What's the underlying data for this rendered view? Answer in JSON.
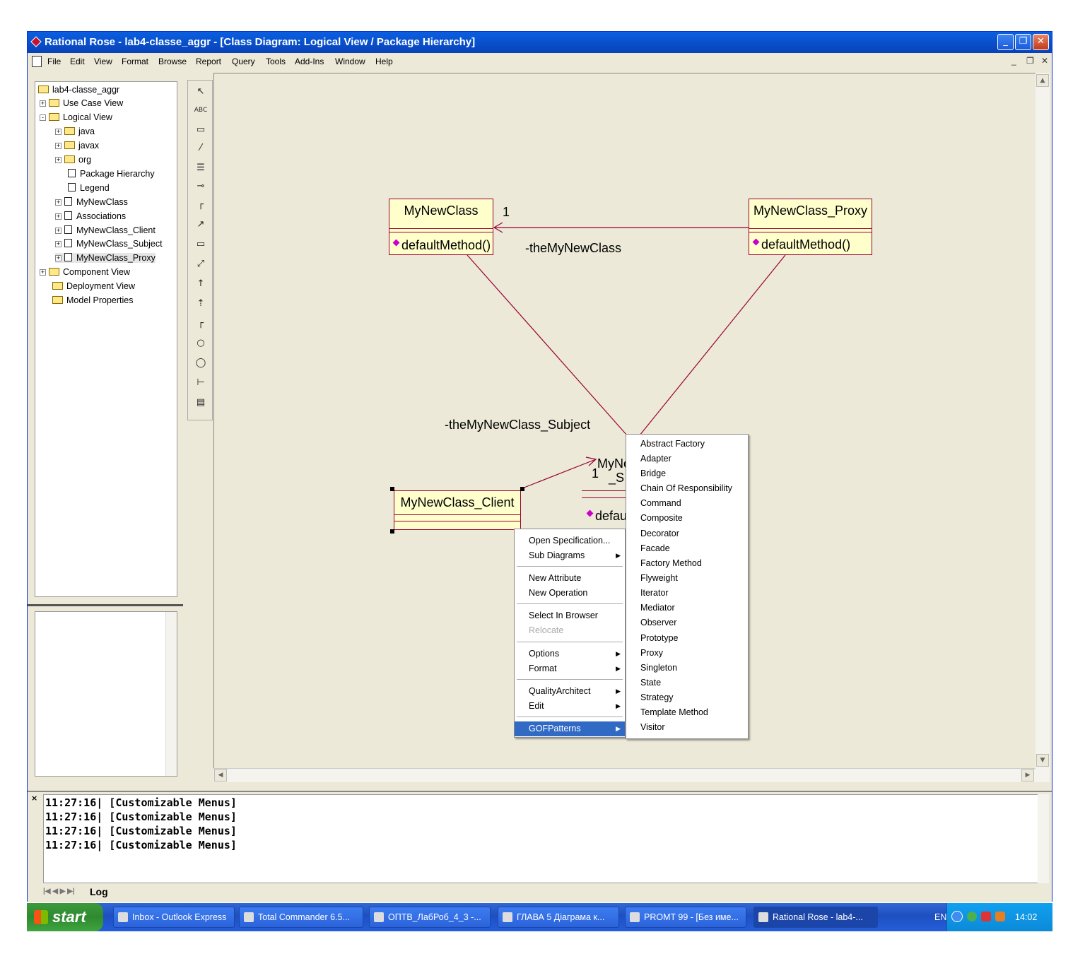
{
  "window": {
    "title": "Rational Rose - lab4-classe_aggr - [Class Diagram: Logical View / Package Hierarchy]",
    "minimize_glyph": "_",
    "restore_glyph": "❐",
    "close_glyph": "✕"
  },
  "menubar": {
    "items": [
      "File",
      "Edit",
      "View",
      "Format",
      "Browse",
      "Report",
      "Query",
      "Tools",
      "Add-Ins",
      "Window",
      "Help"
    ],
    "mdi_controls": [
      "_",
      "❐",
      "✕"
    ]
  },
  "browser": {
    "root": "lab4-classe_aggr",
    "nodes": [
      {
        "label": "Use Case View",
        "expander": "+"
      },
      {
        "label": "Logical View",
        "expander": "-"
      },
      {
        "label": "java",
        "expander": "+"
      },
      {
        "label": "javax",
        "expander": "+"
      },
      {
        "label": "org",
        "expander": "+"
      },
      {
        "label": "Package Hierarchy",
        "expander": ""
      },
      {
        "label": "Legend",
        "expander": ""
      },
      {
        "label": "MyNewClass",
        "expander": "+"
      },
      {
        "label": "Associations",
        "expander": "+"
      },
      {
        "label": "MyNewClass_Client",
        "expander": "+"
      },
      {
        "label": "MyNewClass_Subject",
        "expander": "+"
      },
      {
        "label": "MyNewClass_Proxy",
        "expander": "+"
      },
      {
        "label": "Component View",
        "expander": "+"
      },
      {
        "label": "Deployment View",
        "expander": ""
      },
      {
        "label": "Model Properties",
        "expander": ""
      }
    ]
  },
  "toolbox": {
    "tools": [
      "pointer-icon",
      "text-icon",
      "note-icon",
      "anchor-note-icon",
      "class-icon",
      "interface-icon",
      "association-icon",
      "unidirectional-association-icon",
      "package-icon",
      "dependency-icon",
      "generalization-icon",
      "realize-icon",
      "aggregation-icon",
      "boundary-icon",
      "entity-icon",
      "control-icon",
      "component-icon"
    ],
    "text_tool_label": "ABC"
  },
  "diagram": {
    "classes": {
      "mynewclass": {
        "name": "MyNewClass",
        "operation": "defaultMethod()"
      },
      "proxy": {
        "name": "MyNewClass_Proxy",
        "operation": "defaultMethod()"
      },
      "client": {
        "name": "MyNewClass_Client"
      },
      "subject_partial": {
        "name_line1": "MyNe",
        "name_line2": "_S",
        "operation_partial": "defau"
      }
    },
    "labels": {
      "multiplicity_1": "1",
      "multiplicity_2": "1",
      "role_the_my_new_class": "-theMyNewClass",
      "role_the_my_new_class_subject": "-theMyNewClass_Subject"
    }
  },
  "context_menu": {
    "groups": [
      [
        {
          "label": "Open Specification...",
          "submenu": false,
          "disabled": false
        },
        {
          "label": "Sub Diagrams",
          "submenu": true,
          "disabled": false
        }
      ],
      [
        {
          "label": "New Attribute",
          "submenu": false,
          "disabled": false
        },
        {
          "label": "New Operation",
          "submenu": false,
          "disabled": false
        }
      ],
      [
        {
          "label": "Select In Browser",
          "submenu": false,
          "disabled": false
        },
        {
          "label": "Relocate",
          "submenu": false,
          "disabled": true
        }
      ],
      [
        {
          "label": "Options",
          "submenu": true,
          "disabled": false
        },
        {
          "label": "Format",
          "submenu": true,
          "disabled": false
        }
      ],
      [
        {
          "label": "QualityArchitect",
          "submenu": true,
          "disabled": false
        },
        {
          "label": "Edit",
          "submenu": true,
          "disabled": false
        }
      ],
      [
        {
          "label": "GOFPatterns",
          "submenu": true,
          "disabled": false,
          "selected": true
        }
      ]
    ],
    "submenu_arrow": "▶"
  },
  "gof_submenu": {
    "items": [
      "Abstract Factory",
      "Adapter",
      "Bridge",
      "Chain Of Responsibility",
      "Command",
      "Composite",
      "Decorator",
      "Facade",
      "Factory Method",
      "Flyweight",
      "Iterator",
      "Mediator",
      "Observer",
      "Prototype",
      "Proxy",
      "Singleton",
      "State",
      "Strategy",
      "Template Method",
      "Visitor"
    ]
  },
  "log": {
    "lines": [
      "11:27:16|  [Customizable Menus]",
      "11:27:16|  [Customizable Menus]",
      "11:27:16|  [Customizable Menus]",
      "11:27:16|  [Customizable Menus]"
    ],
    "tab_label": "Log",
    "close_glyph": "×"
  },
  "taskbar": {
    "start_label": "start",
    "items": [
      {
        "label": "Inbox - Outlook Express",
        "active": false
      },
      {
        "label": "Total Commander 6.5...",
        "active": false
      },
      {
        "label": "ОПТВ_ЛабРоб_4_3 -...",
        "active": false
      },
      {
        "label": "ГЛАВА 5 Діаграма к...",
        "active": false
      },
      {
        "label": "PROMT 99 - [Без име...",
        "active": false
      },
      {
        "label": "Rational Rose - lab4-...",
        "active": true
      }
    ],
    "tray": {
      "language": "EN",
      "clock": "14:02"
    }
  },
  "colors": {
    "titlebar": "#0a5fe0",
    "class_fill": "#ffffcc",
    "class_border": "#990033",
    "association_line": "#990033",
    "menu_highlight": "#316ac5",
    "operation_icon": "#cc00cc"
  }
}
